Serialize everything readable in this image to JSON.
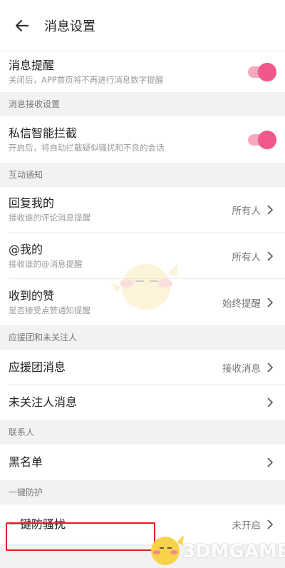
{
  "header": {
    "title": "消息设置"
  },
  "rows": {
    "notify": {
      "label": "消息提醒",
      "sub": "关闭后，APP首页将不再进行消息数字提醒",
      "on": true
    },
    "dm_filter": {
      "label": "私信智能拦截",
      "sub": "开启后，将自动拦截疑似骚扰和不良的会话",
      "on": true
    },
    "reply": {
      "label": "回复我的",
      "sub": "接收谁的评论消息提醒",
      "value": "所有人"
    },
    "mention": {
      "label": "@我的",
      "sub": "接收谁的@消息提醒",
      "value": "所有人"
    },
    "likes": {
      "label": "收到的赞",
      "sub": "是否接受点赞通知提醒",
      "value": "始终提醒"
    },
    "fanclub": {
      "label": "应援团消息",
      "value": "接收消息"
    },
    "unfollowed": {
      "label": "未关注人消息"
    },
    "blacklist": {
      "label": "黑名单"
    },
    "antispam": {
      "label": "一键防骚扰",
      "value": "未开启"
    }
  },
  "sections": {
    "receive": "消息接收设置",
    "interaction": "互动通知",
    "fanclub": "应援团和未关注人",
    "contacts": "联系人",
    "protection": "一键防护"
  },
  "watermark": {
    "text_main": "3DMGAME"
  },
  "colors": {
    "accent": "#f0578a",
    "highlight": "#e02020"
  }
}
